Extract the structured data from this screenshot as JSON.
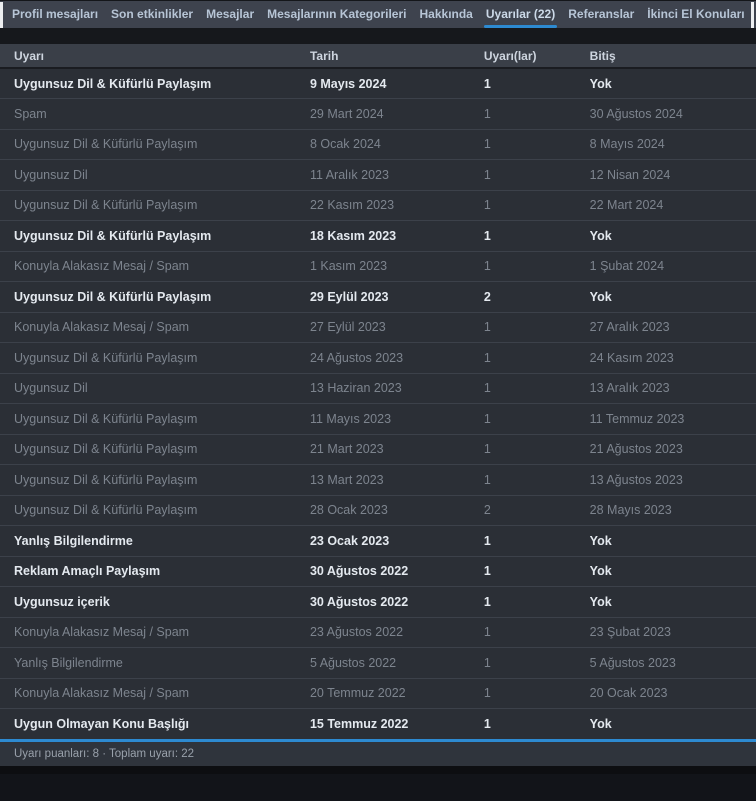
{
  "tabs": [
    {
      "id": "profil-mesajlari",
      "label": "Profil mesajları",
      "active": false
    },
    {
      "id": "son-etkinlikler",
      "label": "Son etkinlikler",
      "active": false
    },
    {
      "id": "mesajlar",
      "label": "Mesajlar",
      "active": false
    },
    {
      "id": "mesajlarinin-kategorileri",
      "label": "Mesajlarının Kategorileri",
      "active": false
    },
    {
      "id": "hakkinda",
      "label": "Hakkında",
      "active": false
    },
    {
      "id": "uyarilar",
      "label": "Uyarılar (22)",
      "active": true
    },
    {
      "id": "referanslar",
      "label": "Referanslar",
      "active": false
    },
    {
      "id": "ikinci-el-konulari",
      "label": "İkinci El Konuları",
      "active": false
    }
  ],
  "table": {
    "headers": [
      "Uyarı",
      "Tarih",
      "Uyarı(lar)",
      "Bitiş"
    ],
    "rows": [
      {
        "reason": "Uygunsuz Dil & Küfürlü Paylaşım",
        "date": "9 Mayıs 2024",
        "points": "1",
        "expiry": "Yok",
        "status": "active"
      },
      {
        "reason": "Spam",
        "date": "29 Mart 2024",
        "points": "1",
        "expiry": "30 Ağustos 2024",
        "status": "expired"
      },
      {
        "reason": "Uygunsuz Dil & Küfürlü Paylaşım",
        "date": "8 Ocak 2024",
        "points": "1",
        "expiry": "8 Mayıs 2024",
        "status": "expired"
      },
      {
        "reason": "Uygunsuz Dil",
        "date": "11 Aralık 2023",
        "points": "1",
        "expiry": "12 Nisan 2024",
        "status": "expired"
      },
      {
        "reason": "Uygunsuz Dil & Küfürlü Paylaşım",
        "date": "22 Kasım 2023",
        "points": "1",
        "expiry": "22 Mart 2024",
        "status": "expired"
      },
      {
        "reason": "Uygunsuz Dil & Küfürlü Paylaşım",
        "date": "18 Kasım 2023",
        "points": "1",
        "expiry": "Yok",
        "status": "active"
      },
      {
        "reason": "Konuyla Alakasız Mesaj / Spam",
        "date": "1 Kasım 2023",
        "points": "1",
        "expiry": "1 Şubat 2024",
        "status": "expired"
      },
      {
        "reason": "Uygunsuz Dil & Küfürlü Paylaşım",
        "date": "29 Eylül 2023",
        "points": "2",
        "expiry": "Yok",
        "status": "active"
      },
      {
        "reason": "Konuyla Alakasız Mesaj / Spam",
        "date": "27 Eylül 2023",
        "points": "1",
        "expiry": "27 Aralık 2023",
        "status": "expired"
      },
      {
        "reason": "Uygunsuz Dil & Küfürlü Paylaşım",
        "date": "24 Ağustos 2023",
        "points": "1",
        "expiry": "24 Kasım 2023",
        "status": "expired"
      },
      {
        "reason": "Uygunsuz Dil",
        "date": "13 Haziran 2023",
        "points": "1",
        "expiry": "13 Aralık 2023",
        "status": "expired"
      },
      {
        "reason": "Uygunsuz Dil & Küfürlü Paylaşım",
        "date": "11 Mayıs 2023",
        "points": "1",
        "expiry": "11 Temmuz 2023",
        "status": "expired"
      },
      {
        "reason": "Uygunsuz Dil & Küfürlü Paylaşım",
        "date": "21 Mart 2023",
        "points": "1",
        "expiry": "21 Ağustos 2023",
        "status": "expired"
      },
      {
        "reason": "Uygunsuz Dil & Küfürlü Paylaşım",
        "date": "13 Mart 2023",
        "points": "1",
        "expiry": "13 Ağustos 2023",
        "status": "expired"
      },
      {
        "reason": "Uygunsuz Dil & Küfürlü Paylaşım",
        "date": "28 Ocak 2023",
        "points": "2",
        "expiry": "28 Mayıs 2023",
        "status": "expired"
      },
      {
        "reason": "Yanlış Bilgilendirme",
        "date": "23 Ocak 2023",
        "points": "1",
        "expiry": "Yok",
        "status": "active"
      },
      {
        "reason": "Reklam Amaçlı Paylaşım",
        "date": "30 Ağustos 2022",
        "points": "1",
        "expiry": "Yok",
        "status": "active"
      },
      {
        "reason": "Uygunsuz içerik",
        "date": "30 Ağustos 2022",
        "points": "1",
        "expiry": "Yok",
        "status": "active"
      },
      {
        "reason": "Konuyla Alakasız Mesaj / Spam",
        "date": "23 Ağustos 2022",
        "points": "1",
        "expiry": "23 Şubat 2023",
        "status": "expired"
      },
      {
        "reason": "Yanlış Bilgilendirme",
        "date": "5 Ağustos 2022",
        "points": "1",
        "expiry": "5 Ağustos 2023",
        "status": "expired"
      },
      {
        "reason": "Konuyla Alakasız Mesaj / Spam",
        "date": "20 Temmuz 2022",
        "points": "1",
        "expiry": "20 Ocak 2023",
        "status": "expired"
      },
      {
        "reason": "Uygun Olmayan Konu Başlığı",
        "date": "15 Temmuz 2022",
        "points": "1",
        "expiry": "Yok",
        "status": "active"
      }
    ]
  },
  "footer": {
    "warning_points_label": "Uyarı puanları",
    "warning_points": "8",
    "total_warnings_label": "Toplam uyarı",
    "total_warnings": "22",
    "summary": "Uyarı puanları: 8 · Toplam uyarı: 22"
  },
  "colors": {
    "accent_blue": "#2d8ad1",
    "tabbar_bg": "#3e434e",
    "header_bg": "#3a3f48",
    "row_bg": "#2b2f36",
    "footer_bg": "#2f343c",
    "page_bg": "#121419",
    "active_row_text": "#e4e9ef",
    "expired_row_text": "#7d848e"
  }
}
